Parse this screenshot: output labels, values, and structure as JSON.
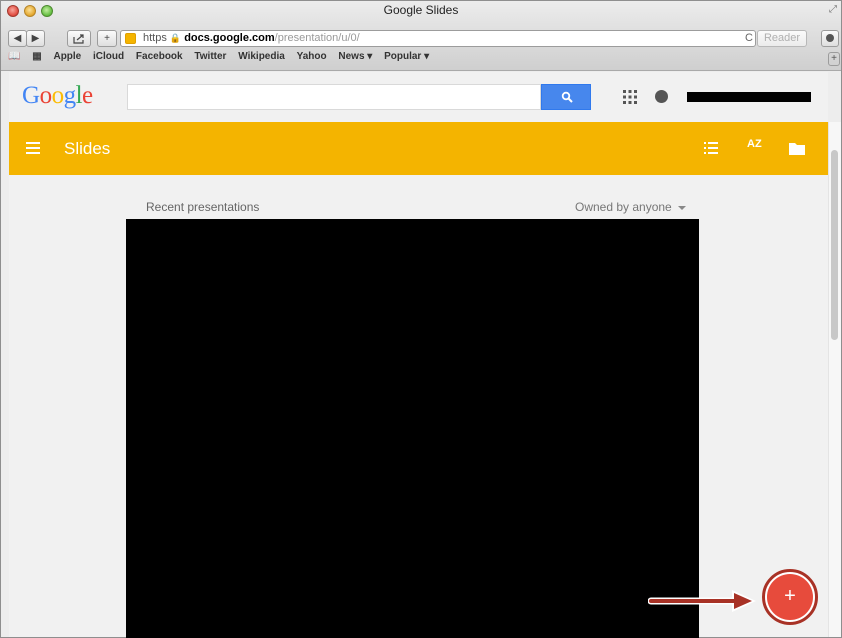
{
  "window": {
    "title": "Google Slides"
  },
  "toolbar": {
    "url_protocol": "https",
    "url_host": "docs.google.com",
    "url_path": "/presentation/u/0/",
    "reader_label": "Reader",
    "reload_symbol": "C",
    "add_symbol": "+"
  },
  "bookmarks": [
    "Apple",
    "iCloud",
    "Facebook",
    "Twitter",
    "Wikipedia",
    "Yahoo",
    "News ▾",
    "Popular ▾"
  ],
  "google_header": {
    "logo_letters": [
      "G",
      "o",
      "o",
      "g",
      "l",
      "e"
    ],
    "logo_colors": [
      "#4285f4",
      "#ea4335",
      "#fbbc05",
      "#4285f4",
      "#34a853",
      "#ea4335"
    ],
    "search_placeholder": ""
  },
  "slides_bar": {
    "title": "Slides",
    "sort_label": "AZ",
    "color": "#f4b400"
  },
  "content": {
    "recent_label": "Recent presentations",
    "owner_filter": "Owned by anyone"
  },
  "fab": {
    "label": "+"
  },
  "icons": [
    "back-icon",
    "forward-icon",
    "share-icon",
    "lock-icon",
    "reload-icon",
    "bookmarks-book-icon",
    "top-sites-grid-icon",
    "search-icon",
    "apps-grid-icon",
    "notifications-icon",
    "hamburger-menu-icon",
    "list-view-icon",
    "sort-az-icon",
    "folder-icon",
    "plus-icon",
    "arrow-annotation-icon"
  ]
}
